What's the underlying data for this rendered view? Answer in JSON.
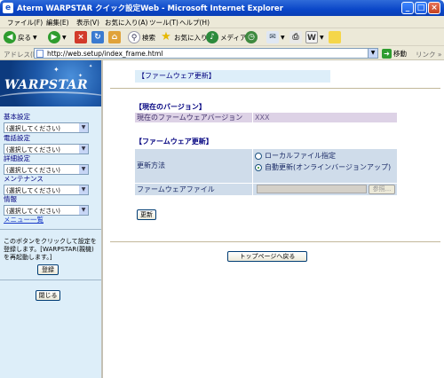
{
  "window": {
    "title": "Aterm WARPSTAR クイック設定Web - Microsoft Internet Explorer",
    "minimize": "_",
    "maximize": "□",
    "close": "×"
  },
  "menubar": [
    "ファイル(F)",
    "編集(E)",
    "表示(V)",
    "お気に入り(A)",
    "ツール(T)",
    "ヘルプ(H)"
  ],
  "toolbar": {
    "back": "戻る",
    "search": "検索",
    "favorites": "お気に入り",
    "media": "メディア"
  },
  "address": {
    "label": "アドレス(D)",
    "url": "http://web.setup/index_frame.html",
    "go": "移動",
    "links": "リンク »"
  },
  "logo": "WARPSTAR",
  "sidebar": {
    "groups": [
      {
        "label": "基本設定",
        "value": "(選択してください)"
      },
      {
        "label": "電話設定",
        "value": "(選択してください)"
      },
      {
        "label": "詳細設定",
        "value": "(選択してください)"
      },
      {
        "label": "メンテナンス",
        "value": "(選択してください)"
      },
      {
        "label": "情報",
        "value": "(選択してください)"
      }
    ],
    "menu_list": "メニュー一覧",
    "note": "このボタンをクリックして設定を登録します。[WARPSTAR(親機)を再起動します。]",
    "register_button": "登録",
    "close_button": "閉じる"
  },
  "main": {
    "page_title": "【ファームウェア更新】",
    "current_version": {
      "heading": "【現在のバージョン】",
      "label": "現在のファームウェアバージョン",
      "value": "XXX"
    },
    "update": {
      "heading": "【ファームウェア更新】",
      "method_label": "更新方法",
      "options": [
        "ローカルファイル指定",
        "自動更新(オンラインバージョンアップ)"
      ],
      "selected_option": "自動更新(オンラインバージョンアップ)",
      "file_label": "ファームウェアファイル",
      "browse_button": "参照...",
      "update_button": "更新"
    },
    "top_page_button": "トップページへ戻る"
  }
}
